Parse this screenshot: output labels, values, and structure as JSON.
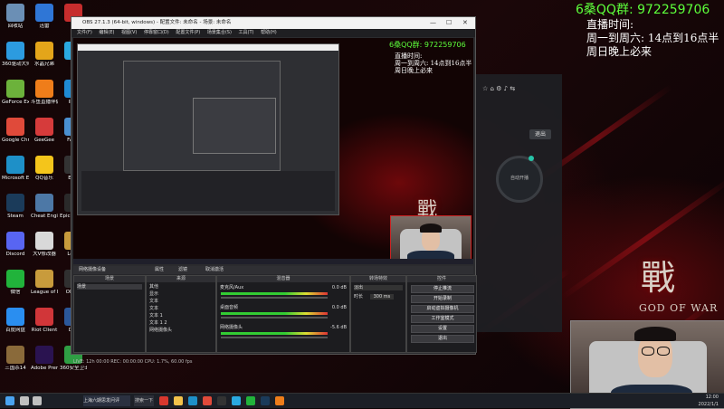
{
  "obs": {
    "title": "OBS 27.1.3 (64-bit, windows) - 配置文件: 未命名 - 场景: 未命名",
    "menu": [
      "文件(F)",
      "编辑(E)",
      "视图(V)",
      "停靠窗口(D)",
      "配置文件(P)",
      "场景集合(S)",
      "工具(T)",
      "帮助(H)"
    ],
    "docks": {
      "scenes_title": "场景",
      "scenes": [
        "场景"
      ],
      "sources_title": "来源",
      "sources": [
        "其他",
        "显示",
        "文本",
        "文本",
        "文本 1",
        "文本 1 2",
        "网络摄像头"
      ],
      "mixer_title": "混音器",
      "mixer": [
        {
          "name": "麦克风/Aux",
          "level": "0.0 dB"
        },
        {
          "name": "桌面音频",
          "level": "0.0 dB"
        },
        {
          "name": "网络摄像头",
          "level": "-5.6 dB"
        }
      ],
      "transition_title": "转场特效",
      "transition_value": "淡出",
      "duration_label": "时长",
      "duration_value": "300 ms",
      "controls_title": "控件",
      "controls": [
        "停止推流",
        "开始录制",
        "启动虚拟摄像机",
        "工作室模式",
        "设置",
        "退出"
      ]
    },
    "filter_bar": {
      "device": "网络摄像设备",
      "prop_button": "属性",
      "filter_button": "滤镜",
      "deactivate_button": "取消激活"
    },
    "status": "LIVE: 12h 00:00 REC: 00:00:00 CPU: 1.7%, 60.00 fps"
  },
  "overlay": {
    "qq": "6桑QQ群: 972259706",
    "line1": "直播时间:",
    "line2": "周一到周六: 14点到16点半",
    "line3": "周日晚上必来",
    "logo_char": "戰",
    "logo_text": "GOD OF WAR"
  },
  "side_panel": {
    "exit_label": "退出",
    "circle_label": "自动开播"
  },
  "desktop_icons": [
    {
      "label": "回收站",
      "color": "#6b8fb5"
    },
    {
      "label": "迅雷",
      "color": "#2f76d6"
    },
    {
      "label": "Fo",
      "color": "#c62d2d"
    },
    {
      "label": "360驱动大师",
      "color": "#2c9be0"
    },
    {
      "label": "水晶兄弟",
      "color": "#e4a51a"
    },
    {
      "label": "PP",
      "color": "#2aa9e0"
    },
    {
      "label": "GeForce Experience",
      "color": "#6cb23b"
    },
    {
      "label": "斗鱼直播伴侣",
      "color": "#ef7d1a"
    },
    {
      "label": "IDM",
      "color": "#1f8bd4"
    },
    {
      "label": "Google Chrome",
      "color": "#e04a3a"
    },
    {
      "label": "GeeGee",
      "color": "#d63b3b"
    },
    {
      "label": "FACE",
      "color": "#4a8fd0"
    },
    {
      "label": "Microsoft Edge",
      "color": "#1e90c8"
    },
    {
      "label": "QQ音乐",
      "color": "#f4c51b"
    },
    {
      "label": "Epic",
      "color": "#333333"
    },
    {
      "label": "Steam",
      "color": "#1b3b5a"
    },
    {
      "label": "Cheat Engine",
      "color": "#4d78a6"
    },
    {
      "label": "Epic Launch",
      "color": "#2a2a2a"
    },
    {
      "label": "Discord",
      "color": "#5865f2"
    },
    {
      "label": "大V修改器",
      "color": "#d9d9d9"
    },
    {
      "label": "Leag",
      "color": "#c89b3c"
    },
    {
      "label": "微信",
      "color": "#21b33b"
    },
    {
      "label": "League of Legends",
      "color": "#c89b3c"
    },
    {
      "label": "OBS S",
      "color": "#303030"
    },
    {
      "label": "百度网盘",
      "color": "#2a8ef0"
    },
    {
      "label": "Riot Client",
      "color": "#d13639"
    },
    {
      "label": "Doc",
      "color": "#2b579a"
    },
    {
      "label": "三国杀14",
      "color": "#8a6a3a"
    },
    {
      "label": "Adobe Premie...",
      "color": "#2a1350"
    },
    {
      "label": "360安全卫士",
      "color": "#2f9e44"
    }
  ],
  "taskbar": {
    "search_label": "搜索一下",
    "tray_time": "12:00",
    "tray_date": "2022/1/1",
    "icons": [
      {
        "name": "start-icon",
        "color": "#4aa3f0"
      },
      {
        "name": "search-icon",
        "color": "#c0c0c0"
      },
      {
        "name": "task-view-icon",
        "color": "#c0c0c0"
      },
      {
        "name": "shanghai-app-icon",
        "color": "#d8382e"
      },
      {
        "name": "folder-icon",
        "color": "#f3c24a"
      },
      {
        "name": "edge-icon",
        "color": "#1e90c8"
      },
      {
        "name": "chrome-icon",
        "color": "#e04a3a"
      },
      {
        "name": "obs-icon",
        "color": "#333333"
      },
      {
        "name": "qq-icon",
        "color": "#2aa9e0"
      },
      {
        "name": "wechat-icon",
        "color": "#21b33b"
      },
      {
        "name": "steam-icon",
        "color": "#1b3b5a"
      },
      {
        "name": "douyu-icon",
        "color": "#ef7d1a"
      }
    ]
  },
  "taskbar_app_label": "上海六期思发问评"
}
